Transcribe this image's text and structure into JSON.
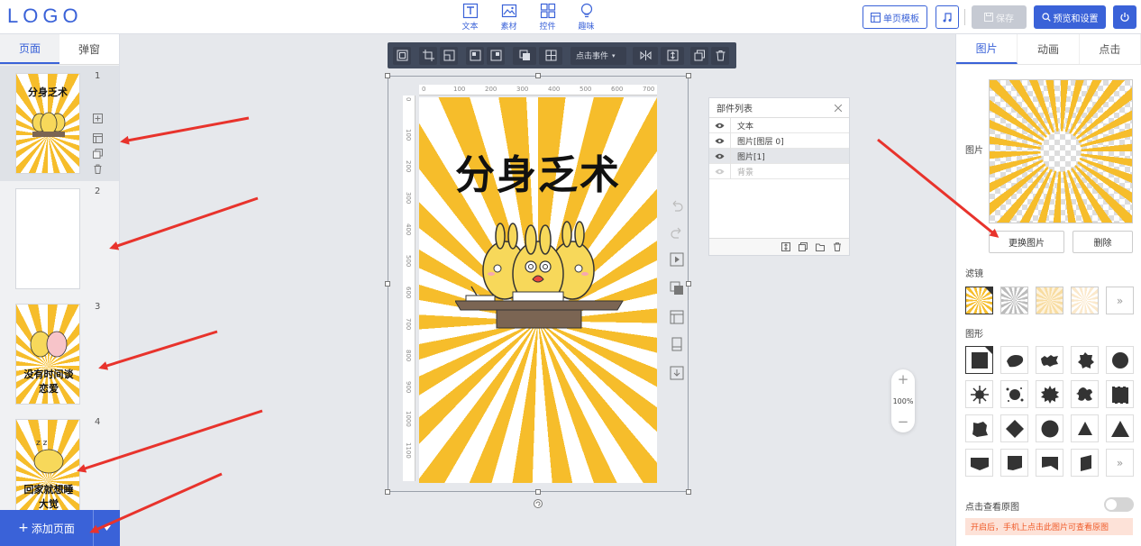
{
  "header": {
    "logo": "LOGO",
    "tools": [
      {
        "label": "文本",
        "icon": "text-icon"
      },
      {
        "label": "素材",
        "icon": "image-icon"
      },
      {
        "label": "控件",
        "icon": "widgets-icon"
      },
      {
        "label": "趣味",
        "icon": "lightbulb-icon"
      }
    ],
    "template_button": "单页模板",
    "save_button": "保存",
    "preview_button": "预览和设置"
  },
  "left_panel": {
    "tabs": [
      "页面",
      "弹窗"
    ],
    "active_tab": "页面",
    "pages": [
      {
        "number": "1",
        "thumb_text": "分身乏术"
      },
      {
        "number": "2",
        "thumb_text": ""
      },
      {
        "number": "3",
        "thumb_text": "没有时间谈恋爱"
      },
      {
        "number": "4",
        "thumb_text": "回家就想睡大觉"
      }
    ],
    "add_page": "添加页面"
  },
  "toolbar": {
    "click_event": "点击事件"
  },
  "ruler": {
    "top": [
      "0",
      "100",
      "200",
      "300",
      "400",
      "500",
      "600",
      "700"
    ],
    "left": [
      "0",
      "100",
      "200",
      "300",
      "400",
      "500",
      "600",
      "700",
      "800",
      "900",
      "1000",
      "1100"
    ]
  },
  "canvas": {
    "title": "分身乏术"
  },
  "component_list": {
    "title": "部件列表",
    "items": [
      {
        "label": "文本",
        "state": "normal"
      },
      {
        "label": "图片[图层 0]",
        "state": "normal"
      },
      {
        "label": "图片[1]",
        "state": "selected"
      },
      {
        "label": "背景",
        "state": "hidden"
      }
    ]
  },
  "zoom": {
    "plus": "+",
    "level": "100%",
    "minus": "−"
  },
  "right_panel": {
    "tabs": [
      "图片",
      "动画",
      "点击"
    ],
    "active_tab": "图片",
    "image_label": "图片",
    "replace_button": "更换图片",
    "delete_button": "删除",
    "filter_label": "滤镜",
    "shape_label": "图形",
    "view_original_label": "点击查看原图",
    "tip": "开启后，手机上点击此图片可查看原图",
    "view_original_enabled": false
  },
  "colors": {
    "accent": "#3a62d8",
    "burst_yellow": "#f6bd2b",
    "arrow_red": "#e8332c"
  }
}
